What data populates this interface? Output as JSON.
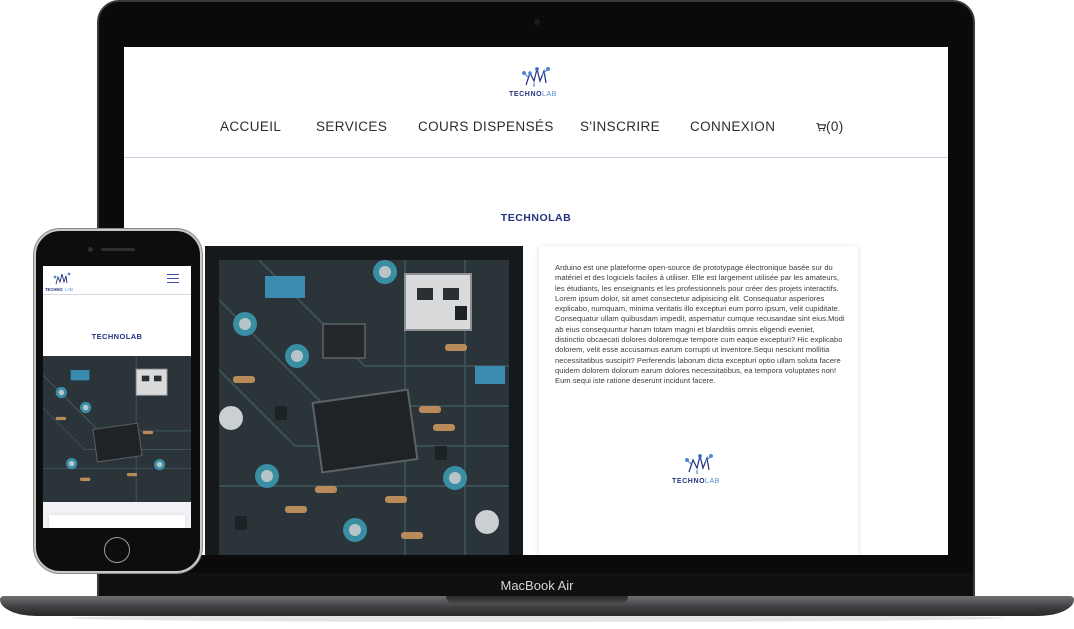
{
  "laptop": {
    "brand_label": "MacBook Air"
  },
  "site": {
    "logo": {
      "word_bold": "TECHNO",
      "word_light": "LAB"
    },
    "nav": {
      "items": [
        "ACCUEIL",
        "SERVICES",
        "COURS DISPENSÉS",
        "S'INSCRIRE",
        "CONNEXION"
      ],
      "cart_label": "(0)"
    },
    "heading": "TECHNOLAB",
    "image_alt_icon": "circuit-board-image",
    "card": {
      "paragraph_1": "Arduino est une plateforme open-source de prototypage électronique basée sur du matériel et des logiciels faciles à utiliser. Elle est largement utilisée par les amateurs, les étudiants, les enseignants et les professionnels pour créer des projets interactifs.",
      "paragraph_2": "Lorem ipsum dolor, sit amet consectetur adipisicing elit. Consequatur asperiores explicabo, numquam, minima veritatis illo excepturi eum porro ipsum, velit cupiditate. Consequatur ullam quibusdam impedit, aspernatur cumque recusandae sint eius.Modi ab eius consequuntur harum totam magni et blanditiis omnis eligendi eveniet, distinctio obcaecati dolores doloremque tempore cum eaque excepturi? Hic explicabo dolorem, velit esse accusamus earum corrupti ut inventore.Sequi nesciunt mollitia necessitatibus suscipit? Perferendis laborum dicta excepturi optio ullam soluta facere quidem dolorem dolorum earum dolores necessitatibus, ea tempora voluptates non! Eum sequi iste ratione deserunt incidunt facere.",
      "logo": {
        "word_bold": "TECHNO",
        "word_light": "LAB"
      }
    }
  },
  "phone": {
    "logo": {
      "word_bold": "TECHNO",
      "word_light": "LAB"
    },
    "heading": "TECHNOLAB",
    "menu_icon": "hamburger-menu-icon"
  },
  "colors": {
    "brand_navy": "#23327e",
    "brand_light_blue": "#4e8bd6",
    "pcb_teal": "#3a8ea3"
  }
}
